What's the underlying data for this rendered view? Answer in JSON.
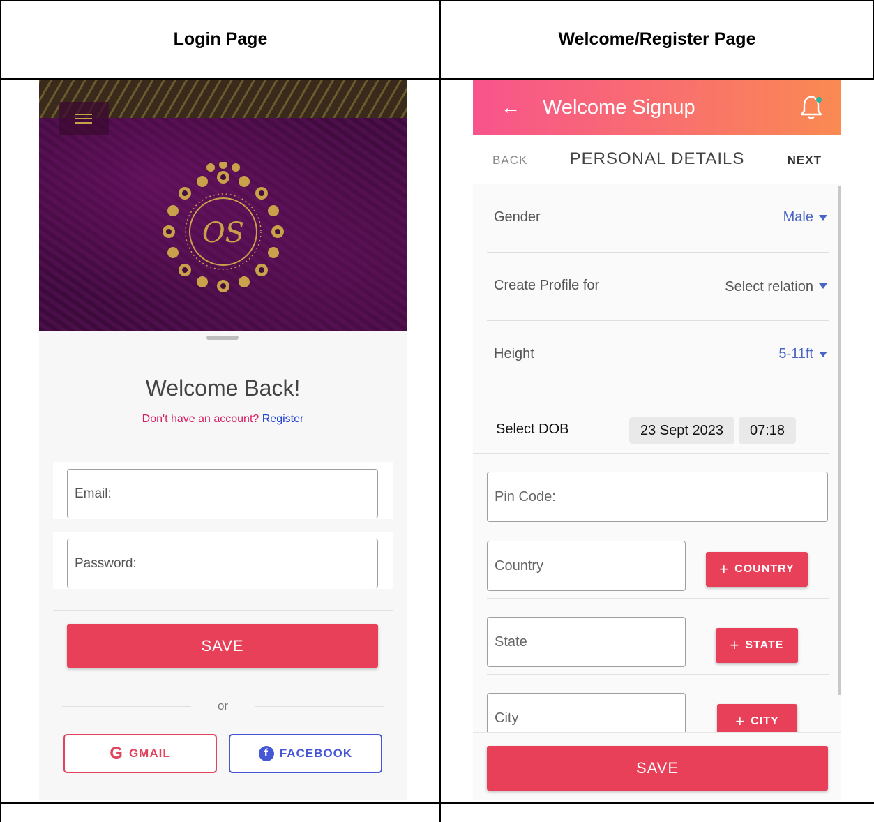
{
  "headers": {
    "left": "Login Page",
    "right": "Welcome/Register Page"
  },
  "login": {
    "welcome_title": "Welcome Back!",
    "account_prompt": "Don't have an account?",
    "register_link": "Register",
    "email_placeholder": "Email:",
    "password_placeholder": "Password:",
    "save_label": "SAVE",
    "or_label": "or",
    "gmail_label": "GMAIL",
    "facebook_label": "FACEBOOK",
    "logo_initials": "OS",
    "accent_color": "#e9405a"
  },
  "register": {
    "appbar_title": "Welcome Signup",
    "step_back_label": "BACK",
    "step_title": "PERSONAL DETAILS",
    "step_next_label": "NEXT",
    "fields": [
      {
        "label": "Gender",
        "value": "Male"
      },
      {
        "label": "Create Profile for",
        "value": "Select relation"
      },
      {
        "label": "Height",
        "value": "5-11ft"
      }
    ],
    "dob_label": "Select DOB",
    "dob_date": "23 Sept 2023",
    "dob_time": "07:18",
    "pincode_placeholder": "Pin Code:",
    "country_placeholder": "Country",
    "country_button": "COUNTRY",
    "state_placeholder": "State",
    "state_button": "STATE",
    "city_placeholder": "City",
    "city_button": "CITY",
    "save_label": "SAVE",
    "gradient_start": "#f8548c",
    "gradient_end": "#fa8a52"
  }
}
